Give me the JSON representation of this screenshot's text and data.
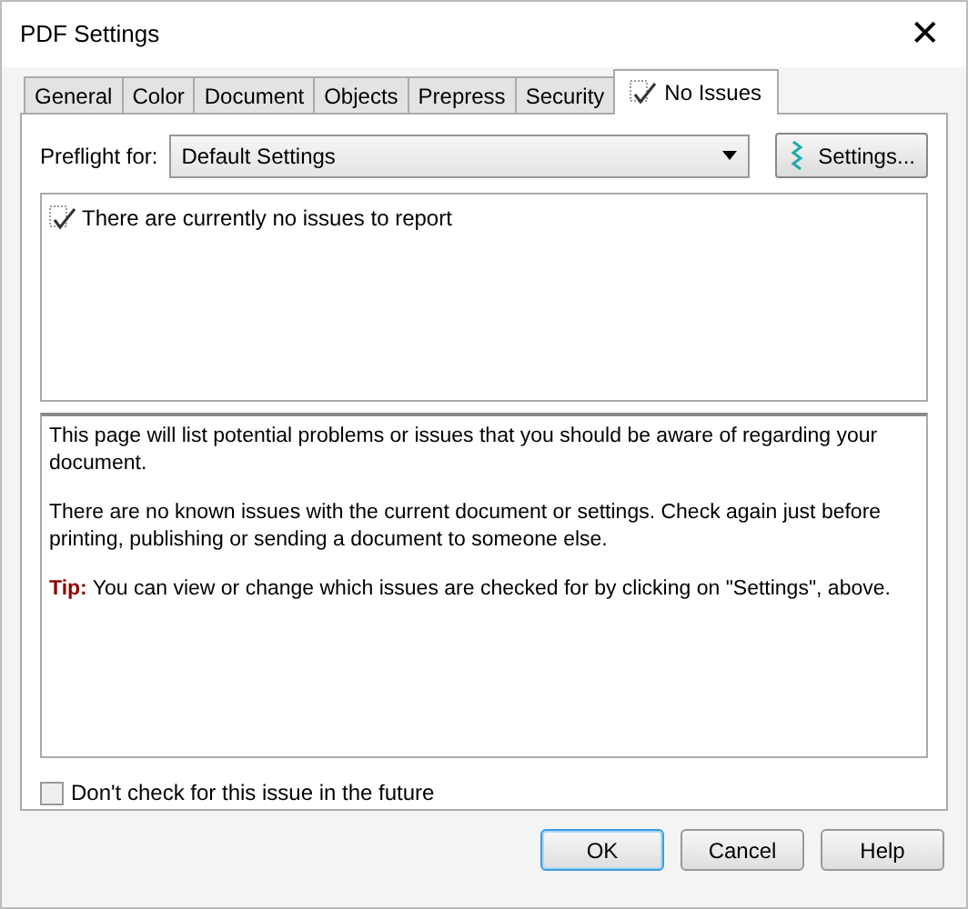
{
  "window": {
    "title": "PDF Settings",
    "close": "✕"
  },
  "tabs": [
    {
      "label": "General",
      "selected": false,
      "kind": "text"
    },
    {
      "label": "Color",
      "selected": false,
      "kind": "text"
    },
    {
      "label": "Document",
      "selected": false,
      "kind": "text"
    },
    {
      "label": "Objects",
      "selected": false,
      "kind": "text"
    },
    {
      "label": "Prepress",
      "selected": false,
      "kind": "text"
    },
    {
      "label": "Security",
      "selected": false,
      "kind": "text"
    },
    {
      "label": "No Issues",
      "selected": true,
      "kind": "check"
    }
  ],
  "preflight": {
    "label": "Preflight for:",
    "value": "Default Settings",
    "button": "Settings..."
  },
  "issues": [
    "There are currently no issues to report"
  ],
  "description": [
    "This page will list potential problems or issues that you should be aware of regarding your document.",
    "There are no known issues with the current document or settings. Check again just before printing, publishing or sending a document to someone else.",
    "**Tip:** You can view or change which issues are checked for by clicking on \"Settings\", above."
  ],
  "dont_check": {
    "label": "Don't check for this issue in the future",
    "checked": false
  },
  "buttons": [
    {
      "label": "OK",
      "default": true
    },
    {
      "label": "Cancel",
      "default": false
    },
    {
      "label": "Help",
      "default": false
    }
  ]
}
